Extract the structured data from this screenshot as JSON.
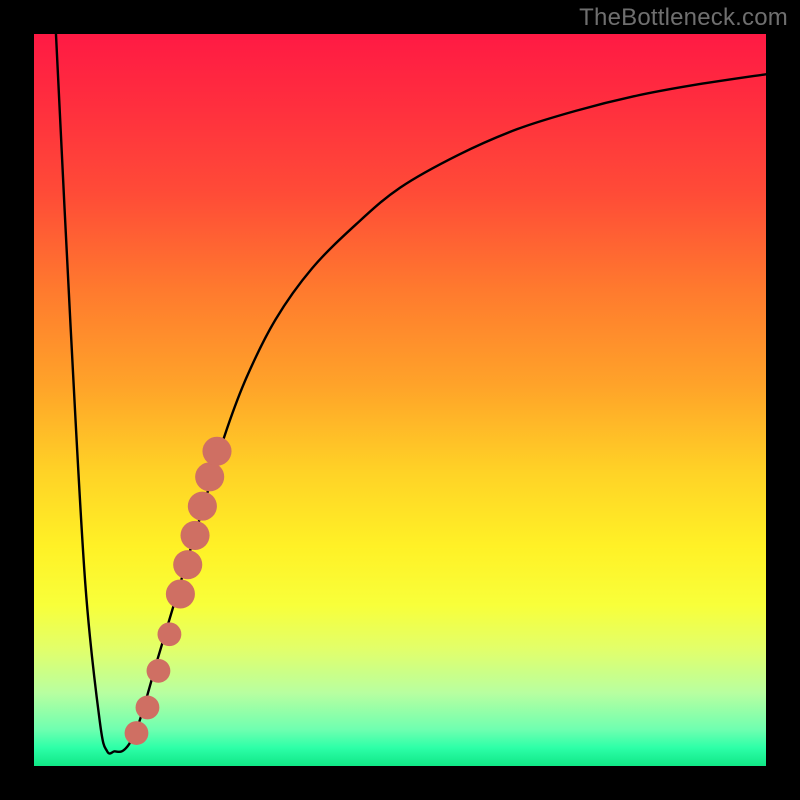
{
  "attribution": "TheBottleneck.com",
  "colors": {
    "frame": "#000000",
    "curve": "#000000",
    "markers": "#cf6f63",
    "gradient_stops": [
      {
        "offset": 0.0,
        "color": "#ff1a44"
      },
      {
        "offset": 0.1,
        "color": "#ff2f3e"
      },
      {
        "offset": 0.22,
        "color": "#ff4c37"
      },
      {
        "offset": 0.35,
        "color": "#ff7a2e"
      },
      {
        "offset": 0.48,
        "color": "#ffa329"
      },
      {
        "offset": 0.6,
        "color": "#ffd326"
      },
      {
        "offset": 0.7,
        "color": "#fff126"
      },
      {
        "offset": 0.78,
        "color": "#f8ff3a"
      },
      {
        "offset": 0.84,
        "color": "#e2ff6a"
      },
      {
        "offset": 0.9,
        "color": "#b8ffa0"
      },
      {
        "offset": 0.95,
        "color": "#6fffb0"
      },
      {
        "offset": 0.975,
        "color": "#2dffa8"
      },
      {
        "offset": 1.0,
        "color": "#10e786"
      }
    ]
  },
  "chart_data": {
    "type": "line",
    "title": "",
    "xlabel": "",
    "ylabel": "",
    "xlim": [
      0,
      100
    ],
    "ylim": [
      0,
      100
    ],
    "series": [
      {
        "name": "bottleneck-curve",
        "x": [
          3,
          5,
          7,
          9,
          10,
          11,
          12,
          13,
          14,
          15,
          17,
          20,
          23,
          26,
          29,
          33,
          38,
          44,
          50,
          58,
          66,
          74,
          82,
          90,
          100
        ],
        "y": [
          100,
          60,
          25,
          6,
          2,
          2,
          2,
          3,
          5,
          8,
          15,
          25,
          35,
          45,
          53,
          61,
          68,
          74,
          79,
          83.5,
          87,
          89.5,
          91.5,
          93,
          94.5
        ]
      }
    ],
    "markers": {
      "name": "highlighted-points",
      "points": [
        {
          "x": 14.0,
          "y": 4.5,
          "r": 1.2
        },
        {
          "x": 15.5,
          "y": 8.0,
          "r": 1.2
        },
        {
          "x": 17.0,
          "y": 13.0,
          "r": 1.2
        },
        {
          "x": 18.5,
          "y": 18.0,
          "r": 1.2
        },
        {
          "x": 20.0,
          "y": 23.5,
          "r": 1.6
        },
        {
          "x": 21.0,
          "y": 27.5,
          "r": 1.6
        },
        {
          "x": 22.0,
          "y": 31.5,
          "r": 1.6
        },
        {
          "x": 23.0,
          "y": 35.5,
          "r": 1.6
        },
        {
          "x": 24.0,
          "y": 39.5,
          "r": 1.6
        },
        {
          "x": 25.0,
          "y": 43.0,
          "r": 1.6
        }
      ]
    }
  }
}
